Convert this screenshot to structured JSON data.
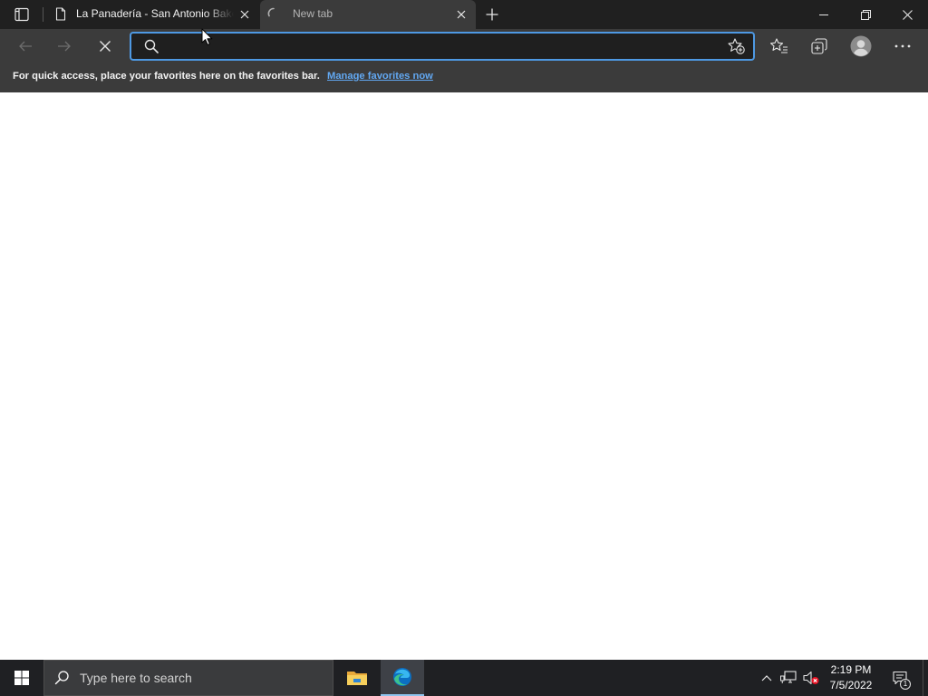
{
  "browser": {
    "tab_strip": {
      "tab_actions_icon": "tab-actions-icon",
      "tabs": [
        {
          "title": "La Panadería - San Antonio Bake",
          "icon": "page-icon",
          "close_icon": "close-icon",
          "active": false
        },
        {
          "title": "New tab",
          "icon": "loading-spinner-icon",
          "close_icon": "close-icon",
          "active": true,
          "loading": true
        }
      ],
      "new_tab_icon": "plus-icon",
      "window_controls": {
        "minimize_icon": "minimize-icon",
        "restore_icon": "restore-icon",
        "close_icon": "close-icon"
      }
    },
    "toolbar": {
      "back": {
        "icon": "back-arrow-icon",
        "enabled": false
      },
      "forward": {
        "icon": "forward-arrow-icon",
        "enabled": false
      },
      "stop": {
        "icon": "stop-loading-icon"
      },
      "address_bar": {
        "value": "",
        "focused": true,
        "search_icon": "search-icon",
        "add_favorite_icon": "star-add-icon"
      },
      "favorites_icon": "favorites-icon",
      "collections_icon": "collections-icon",
      "profile_icon": "profile-avatar-icon",
      "more_icon": "more-options-icon"
    },
    "favorites_bar": {
      "message": "For quick access, place your favorites here on the favorites bar.",
      "link": "Manage favorites now"
    }
  },
  "taskbar": {
    "start_icon": "windows-logo-icon",
    "search": {
      "icon": "search-icon",
      "placeholder": "Type here to search"
    },
    "pinned_apps": [
      {
        "icon": "file-explorer-icon",
        "running": false
      },
      {
        "icon": "edge-icon",
        "running": true
      }
    ],
    "tray": {
      "show_hidden_icon": "chevron-up-icon",
      "network_icon": "network-ethernet-icon",
      "volume_icon": "volume-muted-icon",
      "time": "2:19 PM",
      "date": "7/5/2022",
      "notifications_icon": "action-center-icon",
      "notification_count": "1"
    }
  },
  "pointer": {
    "icon": "mouse-pointer-icon"
  },
  "colors": {
    "tabstrip-bg": "#202020",
    "toolbar-bg": "#3b3b3b",
    "omnibox-bg": "#1f1f1f",
    "omnibox-border": "#4e99e3",
    "link": "#62a8f2",
    "content-bg": "#ffffff",
    "taskbar-bg": "#1f2023",
    "searchbox-bg": "#3a3b3d",
    "taskbar-active-bg": "#3e4147",
    "taskbar-accent": "#8fc4ee",
    "alert": "#e81123"
  }
}
